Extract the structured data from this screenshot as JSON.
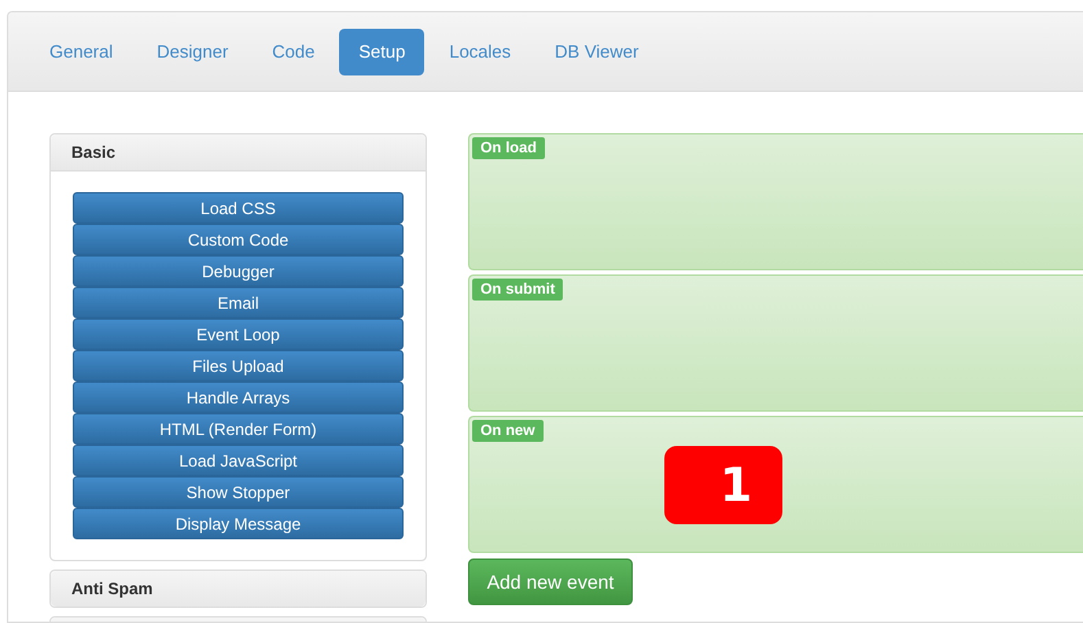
{
  "tabs": [
    {
      "label": "General",
      "selected": false
    },
    {
      "label": "Designer",
      "selected": false
    },
    {
      "label": "Code",
      "selected": false
    },
    {
      "label": "Setup",
      "selected": true
    },
    {
      "label": "Locales",
      "selected": false
    },
    {
      "label": "DB Viewer",
      "selected": false
    }
  ],
  "sidebar": {
    "panels": [
      {
        "title": "Basic",
        "expanded": true,
        "buttons": [
          "Load CSS",
          "Custom Code",
          "Debugger",
          "Email",
          "Event Loop",
          "Files Upload",
          "Handle Arrays",
          "HTML (Render Form)",
          "Load JavaScript",
          "Show Stopper",
          "Display Message"
        ]
      },
      {
        "title": "Anti Spam",
        "expanded": false
      }
    ]
  },
  "events": [
    {
      "label": "On load"
    },
    {
      "label": "On submit"
    },
    {
      "label": "On new",
      "marker": "1"
    }
  ],
  "add_button": "Add new event"
}
